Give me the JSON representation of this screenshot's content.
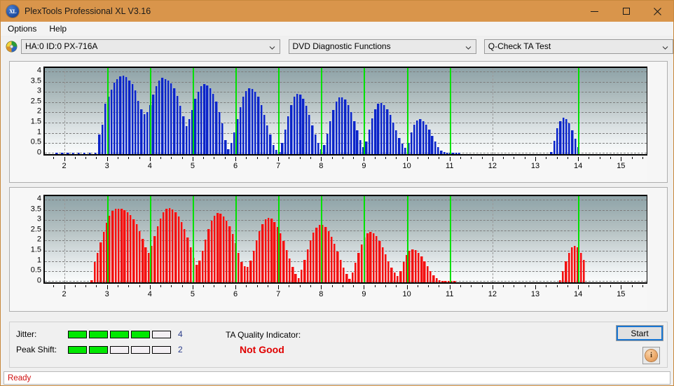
{
  "window": {
    "title": "PlexTools Professional XL V3.16",
    "app_icon": "xl-disc-icon",
    "minimize_label": "Minimize",
    "maximize_label": "Maximize",
    "close_label": "Close"
  },
  "menubar": {
    "items": [
      {
        "label": "Options"
      },
      {
        "label": "Help"
      }
    ]
  },
  "toolbar": {
    "drive": {
      "value": "HA:0 ID:0  PX-716A",
      "icon": "disc-icon"
    },
    "function": {
      "value": "DVD Diagnostic Functions"
    },
    "test": {
      "value": "Q-Check TA Test"
    }
  },
  "indicators": {
    "jitter": {
      "label": "Jitter:",
      "value": "4",
      "filled": 4,
      "total": 5
    },
    "peak_shift": {
      "label": "Peak Shift:",
      "value": "2",
      "filled": 2,
      "total": 5
    },
    "ta_quality": {
      "label": "TA Quality Indicator:",
      "value": "Not Good",
      "color": "#e00000"
    },
    "start_button": {
      "label": "Start"
    },
    "info_button": {
      "label": "i",
      "name": "info-icon"
    }
  },
  "statusbar": {
    "text": "Ready",
    "color": "#d01010"
  },
  "colors": {
    "titlebar": "#d9954b",
    "bar_blue": "#0b24c8",
    "bar_red": "#f21010",
    "marker_green": "#00e000",
    "meter_green": "#00e800",
    "accent_focus": "#1976d2"
  },
  "chart_data": [
    {
      "type": "bar",
      "name": "ta-test-chart-upper",
      "title": "",
      "xlabel": "",
      "ylabel": "",
      "series_color": "#0b24c8",
      "ylim": [
        0,
        4.2
      ],
      "yticks": [
        0,
        0.5,
        1,
        1.5,
        2,
        2.5,
        3,
        3.5,
        4
      ],
      "ytick_labels": [
        "0",
        "0.5",
        "1",
        "1.5",
        "2",
        "2.5",
        "3",
        "3.5",
        "4"
      ],
      "xlim": [
        1.55,
        15.6
      ],
      "xticks": [
        2,
        3,
        4,
        5,
        6,
        7,
        8,
        9,
        10,
        11,
        12,
        13,
        14,
        15
      ],
      "xtick_labels": [
        "2",
        "3",
        "4",
        "5",
        "6",
        "7",
        "8",
        "9",
        "10",
        "11",
        "12",
        "13",
        "14",
        "15"
      ],
      "grid": true,
      "markers_x": [
        3,
        4,
        5,
        6,
        7,
        8,
        9,
        10,
        11,
        14
      ],
      "gridlines_x": [
        2,
        4,
        6,
        8,
        10,
        12,
        14
      ],
      "bar_width": 0.055,
      "x": [
        1.8,
        1.93,
        2.06,
        2.19,
        2.32,
        2.45,
        2.58,
        2.71,
        2.8,
        2.87,
        2.94,
        3.01,
        3.08,
        3.15,
        3.22,
        3.29,
        3.36,
        3.43,
        3.5,
        3.57,
        3.64,
        3.71,
        3.78,
        3.85,
        3.92,
        3.99,
        4.06,
        4.13,
        4.2,
        4.27,
        4.34,
        4.41,
        4.48,
        4.55,
        4.62,
        4.69,
        4.76,
        4.83,
        4.9,
        4.97,
        5.04,
        5.11,
        5.18,
        5.25,
        5.32,
        5.39,
        5.46,
        5.53,
        5.6,
        5.67,
        5.74,
        5.81,
        5.88,
        5.95,
        6.02,
        6.09,
        6.16,
        6.23,
        6.3,
        6.37,
        6.44,
        6.51,
        6.58,
        6.65,
        6.72,
        6.79,
        6.86,
        6.93,
        7.0,
        7.07,
        7.14,
        7.21,
        7.28,
        7.35,
        7.42,
        7.49,
        7.56,
        7.63,
        7.7,
        7.77,
        7.84,
        7.91,
        7.98,
        8.05,
        8.12,
        8.19,
        8.26,
        8.33,
        8.4,
        8.47,
        8.54,
        8.61,
        8.68,
        8.75,
        8.82,
        8.89,
        8.96,
        9.03,
        9.1,
        9.17,
        9.24,
        9.31,
        9.38,
        9.45,
        9.52,
        9.59,
        9.66,
        9.73,
        9.8,
        9.87,
        9.94,
        10.01,
        10.08,
        10.15,
        10.22,
        10.29,
        10.36,
        10.43,
        10.5,
        10.57,
        10.64,
        10.71,
        10.78,
        10.85,
        10.92,
        10.99,
        11.06,
        11.13,
        11.2,
        13.35,
        13.42,
        13.49,
        13.56,
        13.63,
        13.7,
        13.77,
        13.84,
        13.91,
        13.98
      ],
      "values": [
        0.06,
        0.07,
        0.06,
        0.06,
        0.07,
        0.06,
        0.07,
        0.06,
        0.95,
        1.45,
        2.45,
        2.8,
        3.15,
        3.5,
        3.65,
        3.78,
        3.82,
        3.75,
        3.6,
        3.4,
        3.1,
        2.6,
        2.2,
        1.95,
        2.05,
        2.4,
        2.9,
        3.3,
        3.6,
        3.72,
        3.65,
        3.6,
        3.45,
        3.2,
        2.85,
        2.35,
        1.85,
        1.35,
        1.7,
        2.15,
        2.7,
        3.05,
        3.3,
        3.4,
        3.35,
        3.2,
        2.95,
        2.55,
        2.05,
        1.5,
        0.7,
        0.25,
        0.55,
        1.05,
        1.7,
        2.3,
        2.8,
        3.08,
        3.2,
        3.18,
        3.05,
        2.8,
        2.4,
        1.9,
        1.4,
        0.95,
        0.45,
        0.2,
        0.1,
        0.55,
        1.2,
        1.85,
        2.4,
        2.8,
        2.95,
        2.9,
        2.7,
        2.35,
        1.9,
        1.4,
        0.95,
        0.55,
        0.25,
        0.45,
        1.0,
        1.6,
        2.15,
        2.55,
        2.75,
        2.78,
        2.65,
        2.4,
        2.05,
        1.6,
        1.15,
        0.7,
        0.35,
        0.6,
        1.2,
        1.75,
        2.2,
        2.45,
        2.5,
        2.4,
        2.2,
        1.9,
        1.55,
        1.15,
        0.8,
        0.5,
        0.3,
        0.55,
        1.05,
        1.45,
        1.65,
        1.7,
        1.62,
        1.45,
        1.2,
        0.9,
        0.6,
        0.35,
        0.18,
        0.1,
        0.08,
        0.07,
        0.06,
        0.06,
        0.06,
        0.12,
        0.65,
        1.25,
        1.62,
        1.78,
        1.72,
        1.5,
        1.15,
        0.75,
        0.35
      ]
    },
    {
      "type": "bar",
      "name": "ta-test-chart-lower",
      "title": "",
      "xlabel": "",
      "ylabel": "",
      "series_color": "#f21010",
      "ylim": [
        0,
        4.2
      ],
      "yticks": [
        0,
        0.5,
        1,
        1.5,
        2,
        2.5,
        3,
        3.5,
        4
      ],
      "ytick_labels": [
        "0",
        "0.5",
        "1",
        "1.5",
        "2",
        "2.5",
        "3",
        "3.5",
        "4"
      ],
      "xlim": [
        1.55,
        15.6
      ],
      "xticks": [
        2,
        3,
        4,
        5,
        6,
        7,
        8,
        9,
        10,
        11,
        12,
        13,
        14,
        15
      ],
      "xtick_labels": [
        "2",
        "3",
        "4",
        "5",
        "6",
        "7",
        "8",
        "9",
        "10",
        "11",
        "12",
        "13",
        "14",
        "15"
      ],
      "grid": true,
      "markers_x": [
        3,
        4,
        5,
        6,
        7,
        8,
        9,
        10,
        11,
        14
      ],
      "gridlines_x": [
        2,
        4,
        6,
        8,
        10,
        12,
        14
      ],
      "bar_width": 0.055,
      "x": [
        2.62,
        2.69,
        2.76,
        2.83,
        2.9,
        2.97,
        3.04,
        3.11,
        3.18,
        3.25,
        3.32,
        3.39,
        3.46,
        3.53,
        3.6,
        3.67,
        3.74,
        3.81,
        3.88,
        3.95,
        4.02,
        4.09,
        4.16,
        4.23,
        4.3,
        4.37,
        4.44,
        4.51,
        4.58,
        4.65,
        4.72,
        4.79,
        4.86,
        4.93,
        5.0,
        5.07,
        5.14,
        5.21,
        5.28,
        5.35,
        5.42,
        5.49,
        5.56,
        5.63,
        5.7,
        5.77,
        5.84,
        5.91,
        5.98,
        6.05,
        6.12,
        6.19,
        6.26,
        6.33,
        6.4,
        6.47,
        6.54,
        6.61,
        6.68,
        6.75,
        6.82,
        6.89,
        6.96,
        7.03,
        7.1,
        7.17,
        7.24,
        7.31,
        7.38,
        7.45,
        7.52,
        7.59,
        7.66,
        7.73,
        7.8,
        7.87,
        7.94,
        8.01,
        8.08,
        8.15,
        8.22,
        8.29,
        8.36,
        8.43,
        8.5,
        8.57,
        8.64,
        8.71,
        8.78,
        8.85,
        8.92,
        8.99,
        9.06,
        9.13,
        9.2,
        9.27,
        9.34,
        9.41,
        9.48,
        9.55,
        9.62,
        9.69,
        9.76,
        9.83,
        9.9,
        9.97,
        10.04,
        10.11,
        10.18,
        10.25,
        10.32,
        10.39,
        10.46,
        10.53,
        10.6,
        10.67,
        10.74,
        10.81,
        10.88,
        10.95,
        11.02,
        11.09,
        13.55,
        13.62,
        13.69,
        13.76,
        13.83,
        13.9,
        13.97,
        14.04,
        14.11
      ],
      "values": [
        0.1,
        0.98,
        1.42,
        1.95,
        2.45,
        2.9,
        3.25,
        3.48,
        3.58,
        3.6,
        3.58,
        3.52,
        3.42,
        3.28,
        3.08,
        2.82,
        2.5,
        2.12,
        1.72,
        1.45,
        1.78,
        2.25,
        2.72,
        3.1,
        3.4,
        3.58,
        3.62,
        3.55,
        3.42,
        3.22,
        2.95,
        2.6,
        2.18,
        1.7,
        1.2,
        0.85,
        1.05,
        1.55,
        2.1,
        2.6,
        3.0,
        3.25,
        3.38,
        3.35,
        3.22,
        3.02,
        2.72,
        2.35,
        1.92,
        1.45,
        1.0,
        0.78,
        0.75,
        1.05,
        1.55,
        2.05,
        2.5,
        2.85,
        3.08,
        3.15,
        3.1,
        2.95,
        2.7,
        2.38,
        2.0,
        1.58,
        1.15,
        0.75,
        0.4,
        0.22,
        0.62,
        1.1,
        1.6,
        2.05,
        2.42,
        2.68,
        2.8,
        2.8,
        2.7,
        2.5,
        2.22,
        1.88,
        1.5,
        1.1,
        0.72,
        0.4,
        0.18,
        0.48,
        0.95,
        1.42,
        1.85,
        2.18,
        2.38,
        2.45,
        2.4,
        2.25,
        2.0,
        1.7,
        1.35,
        1.02,
        0.72,
        0.48,
        0.3,
        0.55,
        0.98,
        1.32,
        1.55,
        1.62,
        1.58,
        1.45,
        1.25,
        1.02,
        0.78,
        0.55,
        0.35,
        0.2,
        0.12,
        0.08,
        0.07,
        0.06,
        0.06,
        0.06,
        0.1,
        0.55,
        1.02,
        1.42,
        1.7,
        1.78,
        1.7,
        1.45,
        1.1
      ]
    }
  ]
}
